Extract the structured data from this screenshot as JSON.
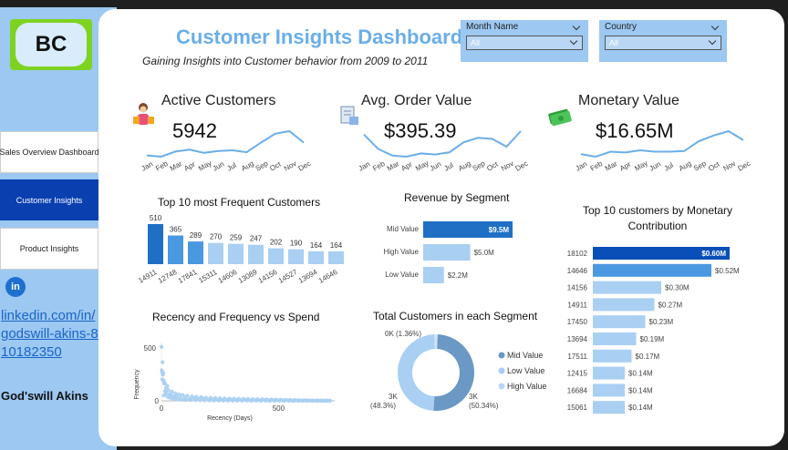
{
  "logo": {
    "text": "BC"
  },
  "nav": [
    {
      "label": "Sales Overview Dashboard"
    },
    {
      "label": "Customer Insights"
    },
    {
      "label": "Product Insights"
    }
  ],
  "contact": {
    "icon": "linkedin-icon",
    "icon_text": "in",
    "link": "linkedin.com/in/godswill-akins-810182350",
    "name": "God'swill Akins"
  },
  "header": {
    "title": "Customer Insights Dashboard",
    "subtitle": "Gaining Insights into Customer behavior from 2009 to 2011"
  },
  "filters": {
    "month": {
      "label": "Month Name",
      "value": "All"
    },
    "country": {
      "label": "Country",
      "value": "All"
    }
  },
  "colors": {
    "dark_blue": "#1f6fc5",
    "mid_blue": "#4a98e0",
    "light_blue": "#a9cff2",
    "accent": "#6aaee8"
  },
  "kpis": [
    {
      "label": "Active Customers",
      "value": "5942",
      "icon": "shopper-icon"
    },
    {
      "label": "Avg. Order Value",
      "value": "$395.39",
      "icon": "invoice-icon"
    },
    {
      "label": "Monetary Value",
      "value": "$16.65M",
      "icon": "money-icon"
    }
  ],
  "chart_data": [
    {
      "type": "line",
      "id": "active_customers_trend",
      "categories": [
        "Jan",
        "Feb",
        "Mar",
        "Apr",
        "May",
        "Jun",
        "Jul",
        "Aug",
        "Sep",
        "Oct",
        "Nov",
        "Dec"
      ],
      "values": [
        320,
        310,
        350,
        365,
        340,
        355,
        360,
        345,
        420,
        490,
        510,
        420
      ]
    },
    {
      "type": "line",
      "id": "avg_order_value_trend",
      "categories": [
        "Jan",
        "Feb",
        "Mar",
        "Apr",
        "May",
        "Jun",
        "Jul",
        "Aug",
        "Sep",
        "Oct",
        "Nov",
        "Dec"
      ],
      "values": [
        430,
        365,
        335,
        330,
        345,
        340,
        350,
        395,
        415,
        410,
        375,
        445
      ]
    },
    {
      "type": "line",
      "id": "monetary_value_trend",
      "categories": [
        "Jan",
        "Feb",
        "Mar",
        "Apr",
        "May",
        "Jun",
        "Jul",
        "Aug",
        "Sep",
        "Oct",
        "Nov",
        "Dec"
      ],
      "values": [
        1.05,
        0.98,
        1.12,
        1.1,
        1.16,
        1.12,
        1.12,
        1.14,
        1.42,
        1.58,
        1.7,
        1.45
      ]
    },
    {
      "type": "bar",
      "id": "top_frequent_customers",
      "title": "Top 10 most Frequent Customers",
      "categories": [
        "14911",
        "12748",
        "17841",
        "15311",
        "14606",
        "13089",
        "14156",
        "14527",
        "13694",
        "14646"
      ],
      "values": [
        510,
        365,
        289,
        270,
        259,
        247,
        202,
        190,
        164,
        164
      ]
    },
    {
      "type": "bar",
      "id": "revenue_by_segment",
      "orientation": "horizontal",
      "title": "Revenue by Segment",
      "categories": [
        "Mid Value",
        "High Value",
        "Low Value"
      ],
      "values": [
        9.5,
        5.0,
        2.2
      ],
      "labels": [
        "$9.5M",
        "$5.0M",
        "$2.2M"
      ]
    },
    {
      "type": "bar",
      "id": "top_monetary_customers",
      "orientation": "horizontal",
      "title": "Top 10 customers by Monetary Contribution",
      "categories": [
        "18102",
        "14646",
        "14156",
        "14911",
        "17450",
        "13694",
        "17511",
        "12415",
        "16684",
        "15061"
      ],
      "values": [
        0.6,
        0.52,
        0.3,
        0.27,
        0.23,
        0.19,
        0.17,
        0.14,
        0.14,
        0.14
      ],
      "labels": [
        "$0.60M",
        "$0.52M",
        "$0.30M",
        "$0.27M",
        "$0.23M",
        "$0.19M",
        "$0.17M",
        "$0.14M",
        "$0.14M",
        "$0.14M"
      ]
    },
    {
      "type": "scatter",
      "id": "recency_frequency_spend",
      "title": "Recency and Frequency vs Spend",
      "xlabel": "Recency (Days)",
      "ylabel": "Frequency",
      "xticks": [
        "0",
        "500"
      ],
      "yticks": [
        "0",
        "500"
      ],
      "xlim": [
        0,
        740
      ],
      "ylim": [
        0,
        560
      ],
      "points": [
        [
          0,
          510
        ],
        [
          5,
          365
        ],
        [
          2,
          289
        ],
        [
          3,
          270
        ],
        [
          8,
          259
        ],
        [
          6,
          247
        ],
        [
          4,
          202
        ],
        [
          10,
          190
        ],
        [
          12,
          164
        ],
        [
          15,
          164
        ],
        [
          20,
          120
        ],
        [
          30,
          100
        ],
        [
          45,
          85
        ],
        [
          60,
          70
        ],
        [
          75,
          60
        ],
        [
          90,
          55
        ],
        [
          110,
          48
        ],
        [
          130,
          42
        ],
        [
          150,
          38
        ],
        [
          170,
          35
        ],
        [
          190,
          30
        ],
        [
          210,
          28
        ],
        [
          230,
          26
        ],
        [
          250,
          24
        ],
        [
          270,
          22
        ],
        [
          290,
          21
        ],
        [
          310,
          20
        ],
        [
          330,
          19
        ],
        [
          350,
          18
        ],
        [
          370,
          17
        ],
        [
          390,
          16
        ],
        [
          410,
          15
        ],
        [
          430,
          14
        ],
        [
          450,
          13
        ],
        [
          470,
          12
        ],
        [
          490,
          11
        ],
        [
          510,
          10
        ],
        [
          530,
          9
        ],
        [
          550,
          8
        ],
        [
          570,
          7
        ],
        [
          590,
          6
        ],
        [
          610,
          5
        ],
        [
          630,
          4
        ],
        [
          650,
          3
        ],
        [
          670,
          2
        ],
        [
          690,
          1
        ],
        [
          710,
          1
        ],
        [
          15,
          90
        ],
        [
          25,
          140
        ],
        [
          35,
          60
        ],
        [
          50,
          40
        ],
        [
          20,
          75
        ],
        [
          40,
          55
        ],
        [
          55,
          30
        ],
        [
          65,
          45
        ],
        [
          80,
          25
        ],
        [
          100,
          35
        ],
        [
          120,
          20
        ],
        [
          140,
          25
        ],
        [
          160,
          15
        ],
        [
          180,
          18
        ],
        [
          200,
          12
        ],
        [
          220,
          14
        ],
        [
          240,
          10
        ],
        [
          260,
          9
        ],
        [
          280,
          8
        ],
        [
          300,
          11
        ],
        [
          320,
          7
        ],
        [
          340,
          6
        ],
        [
          360,
          9
        ],
        [
          380,
          5
        ],
        [
          400,
          6
        ],
        [
          420,
          4
        ],
        [
          440,
          8
        ],
        [
          460,
          3
        ],
        [
          480,
          5
        ],
        [
          500,
          4
        ],
        [
          520,
          3
        ],
        [
          540,
          5
        ],
        [
          560,
          2
        ],
        [
          580,
          4
        ],
        [
          600,
          2
        ],
        [
          620,
          3
        ],
        [
          640,
          2
        ],
        [
          660,
          1
        ],
        [
          680,
          2
        ],
        [
          700,
          1
        ],
        [
          720,
          1
        ],
        [
          10,
          50
        ],
        [
          18,
          60
        ],
        [
          28,
          35
        ],
        [
          38,
          30
        ],
        [
          48,
          22
        ],
        [
          58,
          18
        ],
        [
          68,
          15
        ],
        [
          85,
          12
        ],
        [
          95,
          10
        ],
        [
          105,
          9
        ],
        [
          125,
          8
        ],
        [
          145,
          7
        ],
        [
          165,
          6
        ],
        [
          185,
          5
        ],
        [
          205,
          5
        ],
        [
          225,
          4
        ],
        [
          245,
          4
        ],
        [
          265,
          3
        ],
        [
          285,
          3
        ],
        [
          305,
          2
        ],
        [
          325,
          2
        ],
        [
          345,
          2
        ],
        [
          365,
          3
        ],
        [
          385,
          2
        ],
        [
          405,
          2
        ],
        [
          425,
          1
        ],
        [
          445,
          2
        ],
        [
          465,
          1
        ],
        [
          485,
          1
        ],
        [
          505,
          2
        ],
        [
          525,
          1
        ],
        [
          545,
          1
        ],
        [
          565,
          1
        ],
        [
          585,
          1
        ],
        [
          605,
          1
        ],
        [
          625,
          1
        ],
        [
          645,
          1
        ],
        [
          665,
          1
        ],
        [
          685,
          1
        ],
        [
          705,
          2
        ]
      ]
    },
    {
      "type": "pie",
      "id": "customers_in_segment",
      "donut": true,
      "title": "Total Customers in each Segment",
      "categories": [
        "Mid Value",
        "Low Value",
        "High Value"
      ],
      "values": [
        50.34,
        48.3,
        1.36
      ],
      "labels": [
        "3K (50.34%)",
        "3K (48.3%)",
        "0K (1.36%)"
      ]
    }
  ],
  "axis_months": [
    "Jan",
    "Feb",
    "Mar",
    "Apr",
    "May",
    "Jun",
    "Jul",
    "Aug",
    "Sep",
    "Oct",
    "Nov",
    "Dec"
  ],
  "legend": [
    "Mid Value",
    "Low Value",
    "High Value"
  ],
  "texts": {
    "pie_label_top": "0K (1.36%)",
    "pie_label_left_1": "3K",
    "pie_label_left_2": "(48.3%)",
    "pie_label_right_1": "3K",
    "pie_label_right_2": "(50.34%)"
  }
}
